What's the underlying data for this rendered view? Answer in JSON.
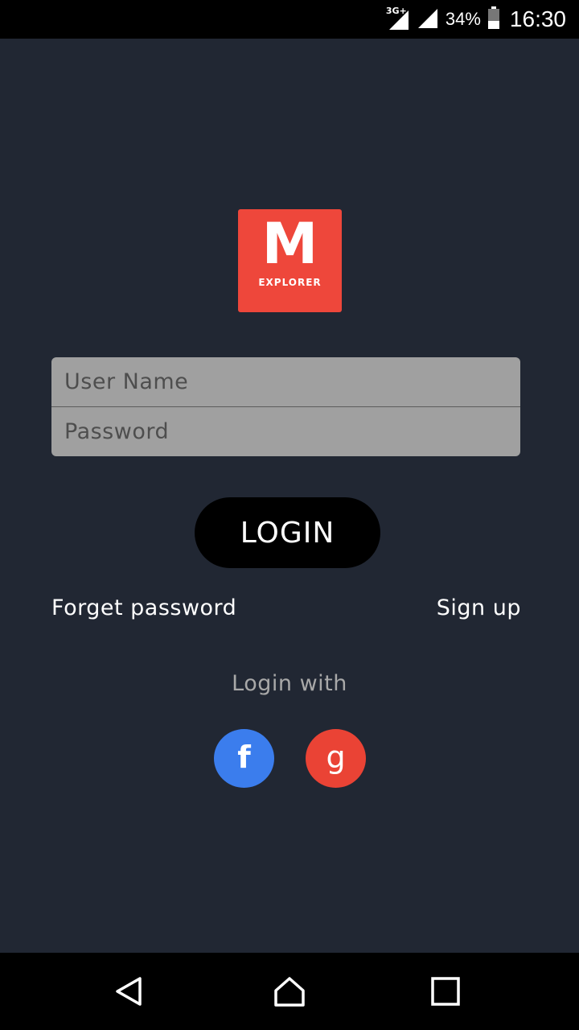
{
  "status_bar": {
    "network_type": "3G+",
    "battery_percent": "34%",
    "time": "16:30",
    "icons": [
      "signal-3g-icon",
      "signal-icon",
      "battery-icon"
    ]
  },
  "logo": {
    "letter": "M",
    "subtitle": "EXPLORER",
    "color": "#ee473b"
  },
  "form": {
    "username_placeholder": "User Name",
    "password_placeholder": "Password"
  },
  "login_button": {
    "label": "LOGIN"
  },
  "links": {
    "forget_password": "Forget password",
    "sign_up": "Sign up"
  },
  "social_login": {
    "heading": "Login with",
    "facebook_label": "f",
    "facebook_color": "#3b7ded",
    "google_label": "g",
    "google_color": "#ea4335"
  },
  "nav_bar": {
    "icons": [
      "back-icon",
      "home-icon",
      "recent-apps-icon"
    ]
  },
  "colors": {
    "background": "#212733",
    "input_background": "#a0a0a0",
    "button_background": "#000000"
  }
}
